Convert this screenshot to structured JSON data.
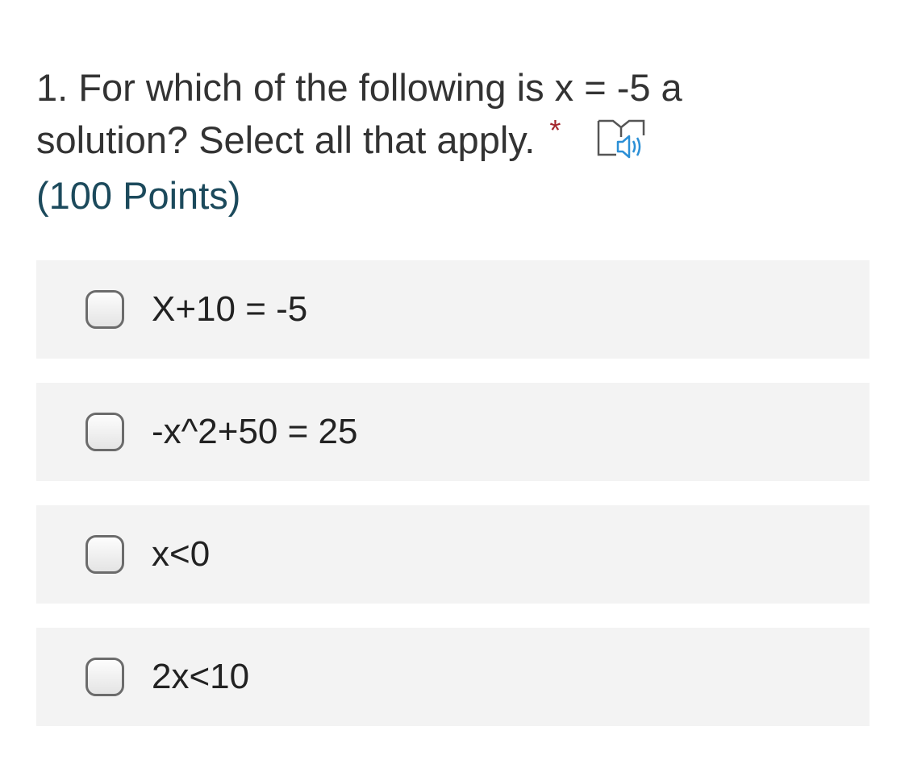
{
  "question": {
    "number": "1.",
    "text_line1": "For which of the following is x = -5 a",
    "text_line2": "solution? Select all that apply.",
    "required_marker": "*",
    "points": "(100 Points)",
    "immersive_reader_icon": "immersive-reader-icon"
  },
  "options": [
    {
      "label": "X+10 = -5",
      "checked": false
    },
    {
      "label": "-x^2+50 = 25",
      "checked": false
    },
    {
      "label": "x<0",
      "checked": false
    },
    {
      "label": "2x<10",
      "checked": false
    }
  ],
  "colors": {
    "required": "#a4262c",
    "points": "#1c4a5c",
    "option_background": "#f3f3f3",
    "speaker_blue": "#2b8fd6"
  }
}
